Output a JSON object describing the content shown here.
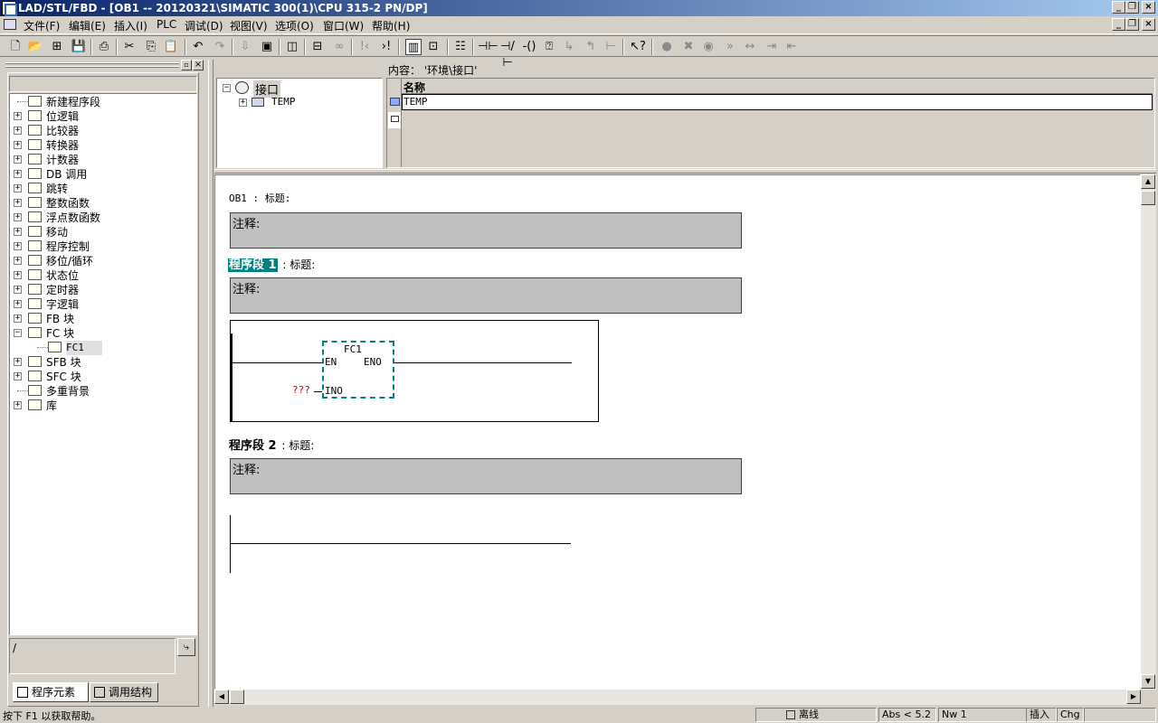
{
  "window": {
    "title": "LAD/STL/FBD  - [OB1 -- 20120321\\SIMATIC 300(1)\\CPU 315-2 PN/DP]"
  },
  "menu": [
    "文件(F)",
    "编辑(E)",
    "插入(I)",
    "PLC",
    "调试(D)",
    "视图(V)",
    "选项(O)",
    "窗口(W)",
    "帮助(H)"
  ],
  "tree": {
    "items": [
      {
        "label": "新建程序段",
        "expand": "",
        "icon": "new-network-icon"
      },
      {
        "label": "位逻辑",
        "expand": "+",
        "icon": "bit-logic-icon"
      },
      {
        "label": "比较器",
        "expand": "+",
        "icon": "comparator-icon"
      },
      {
        "label": "转换器",
        "expand": "+",
        "icon": "converter-icon"
      },
      {
        "label": "计数器",
        "expand": "+",
        "icon": "counter-icon"
      },
      {
        "label": "DB 调用",
        "expand": "+",
        "icon": "db-call-icon"
      },
      {
        "label": "跳转",
        "expand": "+",
        "icon": "jump-icon"
      },
      {
        "label": "整数函数",
        "expand": "+",
        "icon": "integer-function-icon"
      },
      {
        "label": "浮点数函数",
        "expand": "+",
        "icon": "floating-point-icon"
      },
      {
        "label": "移动",
        "expand": "+",
        "icon": "move-icon"
      },
      {
        "label": "程序控制",
        "expand": "+",
        "icon": "program-control-icon"
      },
      {
        "label": "移位/循环",
        "expand": "+",
        "icon": "shift-rotate-icon"
      },
      {
        "label": "状态位",
        "expand": "+",
        "icon": "status-bits-icon"
      },
      {
        "label": "定时器",
        "expand": "+",
        "icon": "timer-icon"
      },
      {
        "label": "字逻辑",
        "expand": "+",
        "icon": "word-logic-icon"
      },
      {
        "label": "FB 块",
        "expand": "+",
        "icon": "fb-block-icon"
      },
      {
        "label": "FC 块",
        "expand": "−",
        "icon": "fc-block-icon"
      },
      {
        "label": "FC1",
        "expand": "",
        "icon": "fc1-icon",
        "indent": true
      },
      {
        "label": "SFB 块",
        "expand": "+",
        "icon": "sfb-block-icon"
      },
      {
        "label": "SFC 块",
        "expand": "+",
        "icon": "sfc-block-icon"
      },
      {
        "label": "多重背景",
        "expand": "",
        "icon": "multi-instance-icon"
      },
      {
        "label": "库",
        "expand": "+",
        "icon": "library-icon"
      }
    ],
    "path_field": "/"
  },
  "tabs": {
    "program_elements": "程序元素",
    "call_structure": "调用结构"
  },
  "interface": {
    "root": "接口",
    "child": "TEMP",
    "content_label": "内容：  '环境\\接口'",
    "column_name": "名称",
    "row1": "TEMP"
  },
  "editor": {
    "block_header": "OB1 : 标题:",
    "comment_label": "注释:",
    "network1_label": "程序段 1",
    "network1_title": ": 标题:",
    "network2_label": "程序段 2",
    "network2_title": ": 标题:",
    "fc_name": "FC1",
    "pin_en": "EN",
    "pin_eno": "ENO",
    "pin_ino": "INO",
    "unassigned": "???"
  },
  "status": {
    "help": "按下 F1 以获取帮助。",
    "mode": "离线",
    "abs": "Abs < 5.2",
    "nw": "Nw 1",
    "insert": "插入",
    "chg": "Chg"
  },
  "colors": {
    "title_gradient_start": "#0a246a",
    "selection": "#008080",
    "block_border": "#008080",
    "unassigned_text": "#cc0000"
  }
}
